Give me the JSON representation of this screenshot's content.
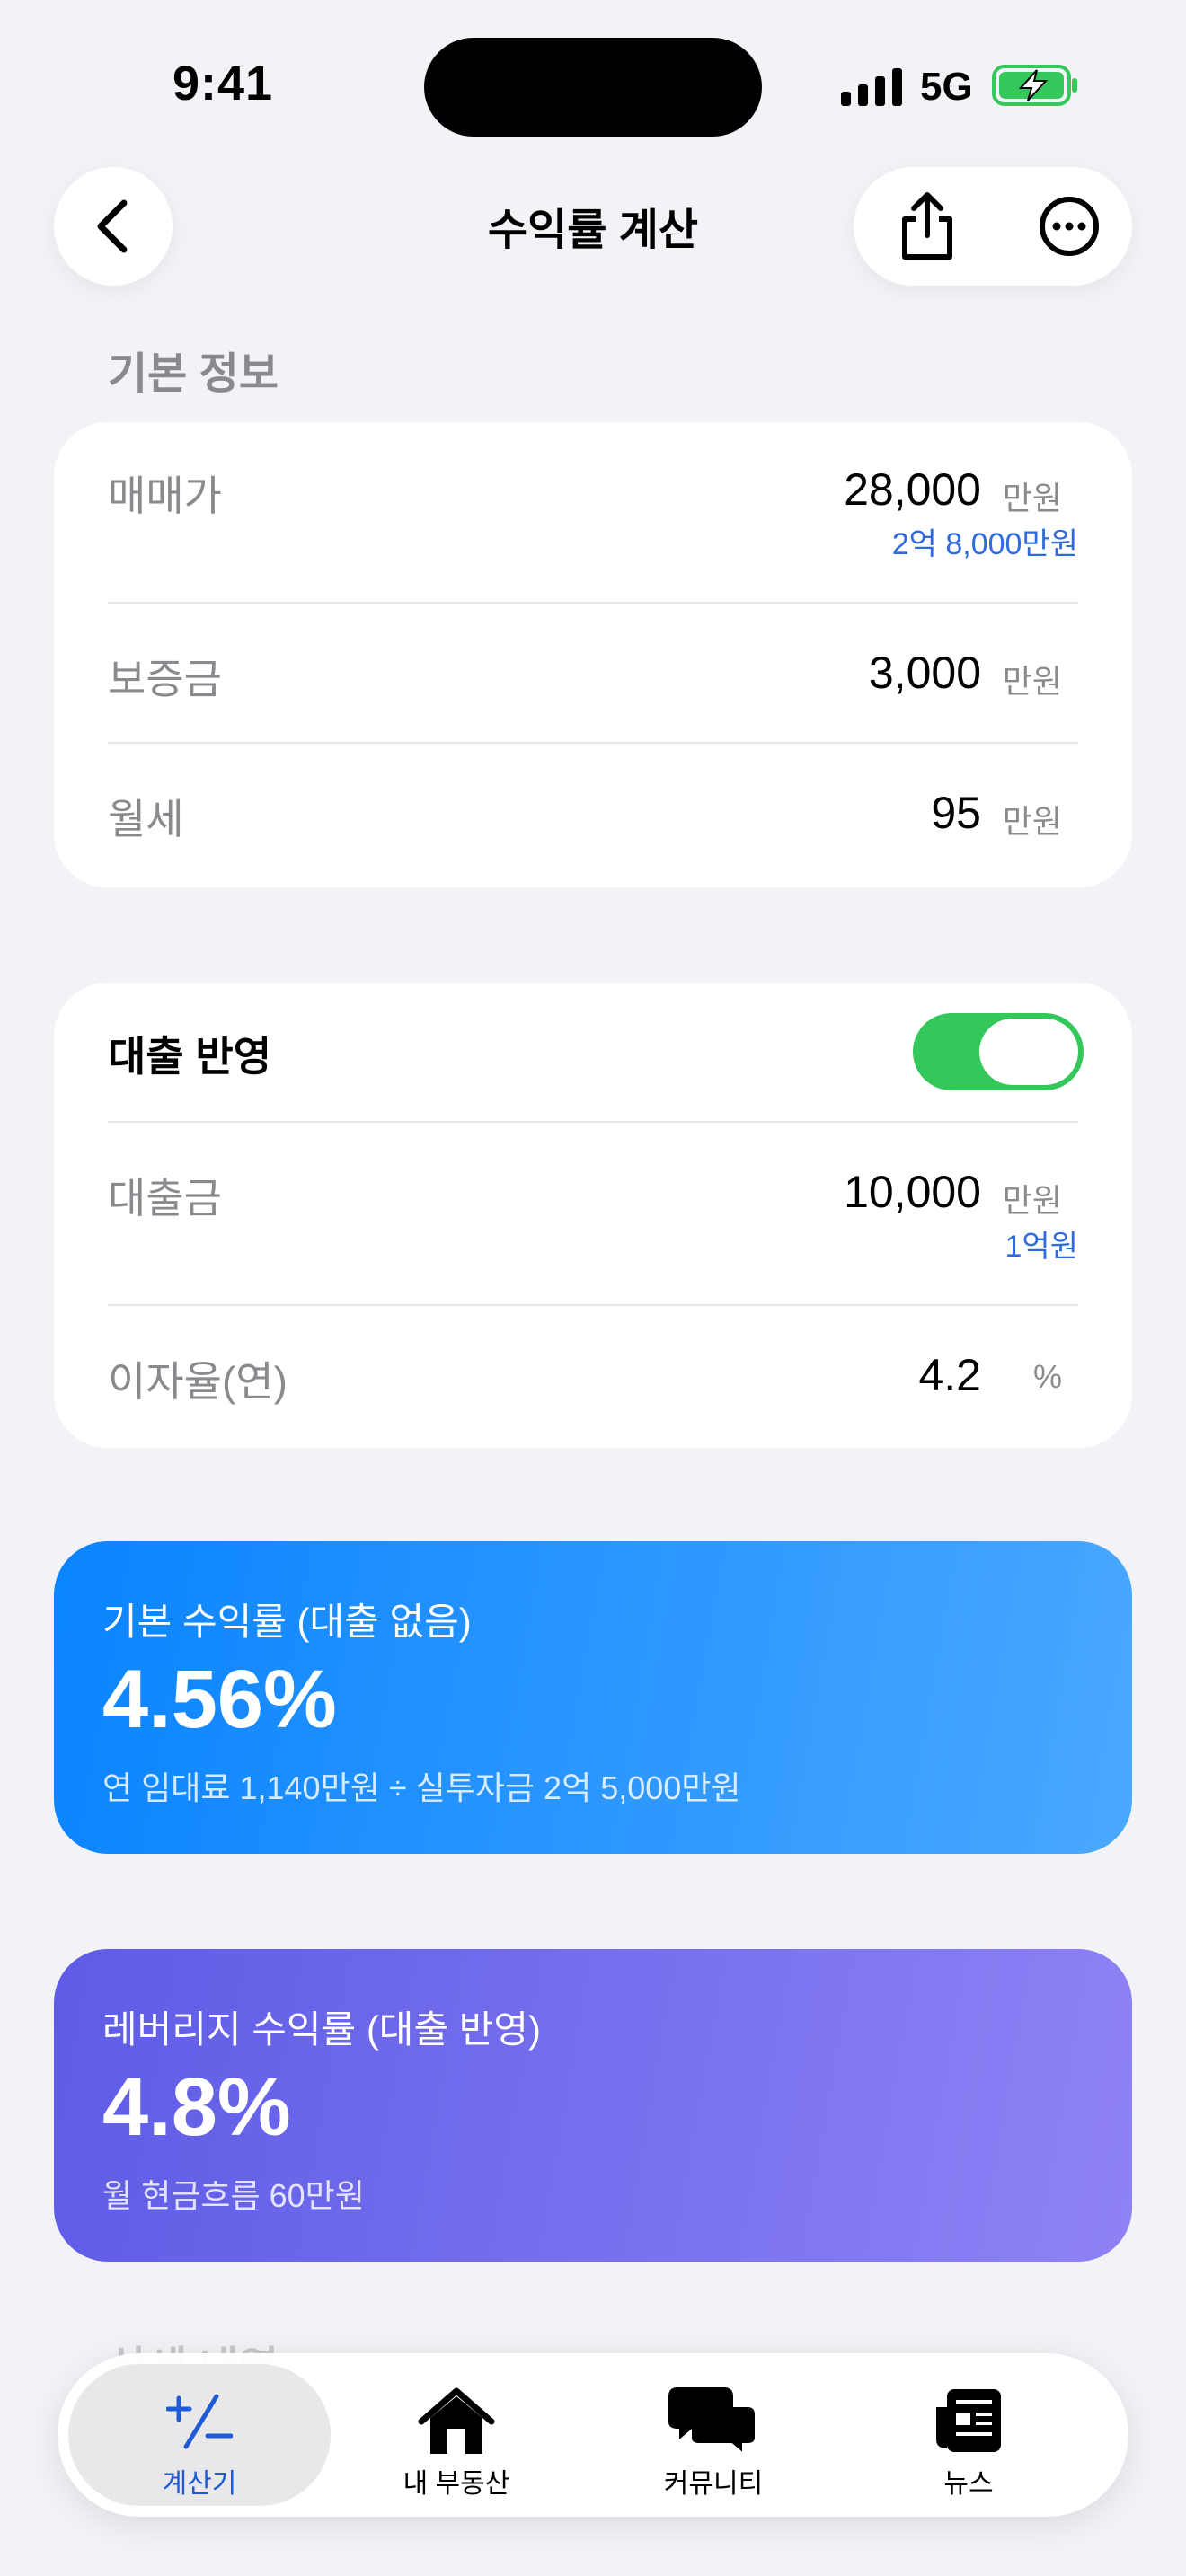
{
  "status": {
    "time": "9:41",
    "network": "5G"
  },
  "nav": {
    "title": "수익률 계산",
    "back_icon": "chevron-left-icon",
    "share_icon": "share-icon",
    "more_icon": "ellipsis-icon"
  },
  "basic": {
    "section_label": "기본 정보",
    "rows": [
      {
        "label": "매매가",
        "value": "28,000",
        "unit": "만원",
        "sub": "2억 8,000만원"
      },
      {
        "label": "보증금",
        "value": "3,000",
        "unit": "만원"
      },
      {
        "label": "월세",
        "value": "95",
        "unit": "만원"
      }
    ]
  },
  "loan": {
    "toggle_label": "대출 반영",
    "toggle_on": true,
    "rows": [
      {
        "label": "대출금",
        "value": "10,000",
        "unit": "만원",
        "sub": "1억원"
      },
      {
        "label": "이자율(연)",
        "value": "4.2",
        "unit": "%"
      }
    ]
  },
  "results": [
    {
      "title": "기본 수익률 (대출 없음)",
      "value": "4.56%",
      "note": "연 임대료 1,140만원 ÷ 실투자금 2억 5,000만원",
      "gradient": [
        "#0a84ff",
        "#4aa8ff"
      ]
    },
    {
      "title": "레버리지 수익률 (대출 반영)",
      "value": "4.8%",
      "note": "월 현금흐름 60만원",
      "gradient": [
        "#5e5ce6",
        "#8e82f5"
      ]
    }
  ],
  "detail_peek": "상세 내역",
  "tabs": [
    {
      "label": "계산기",
      "icon": "calculator-icon",
      "active": true
    },
    {
      "label": "내 부동산",
      "icon": "house-icon",
      "active": false
    },
    {
      "label": "커뮤니티",
      "icon": "chat-bubbles-icon",
      "active": false
    },
    {
      "label": "뉴스",
      "icon": "newspaper-icon",
      "active": false
    }
  ],
  "colors": {
    "accent": "#1e5bd6",
    "toggle": "#34c759",
    "background": "#f2f2f7"
  }
}
